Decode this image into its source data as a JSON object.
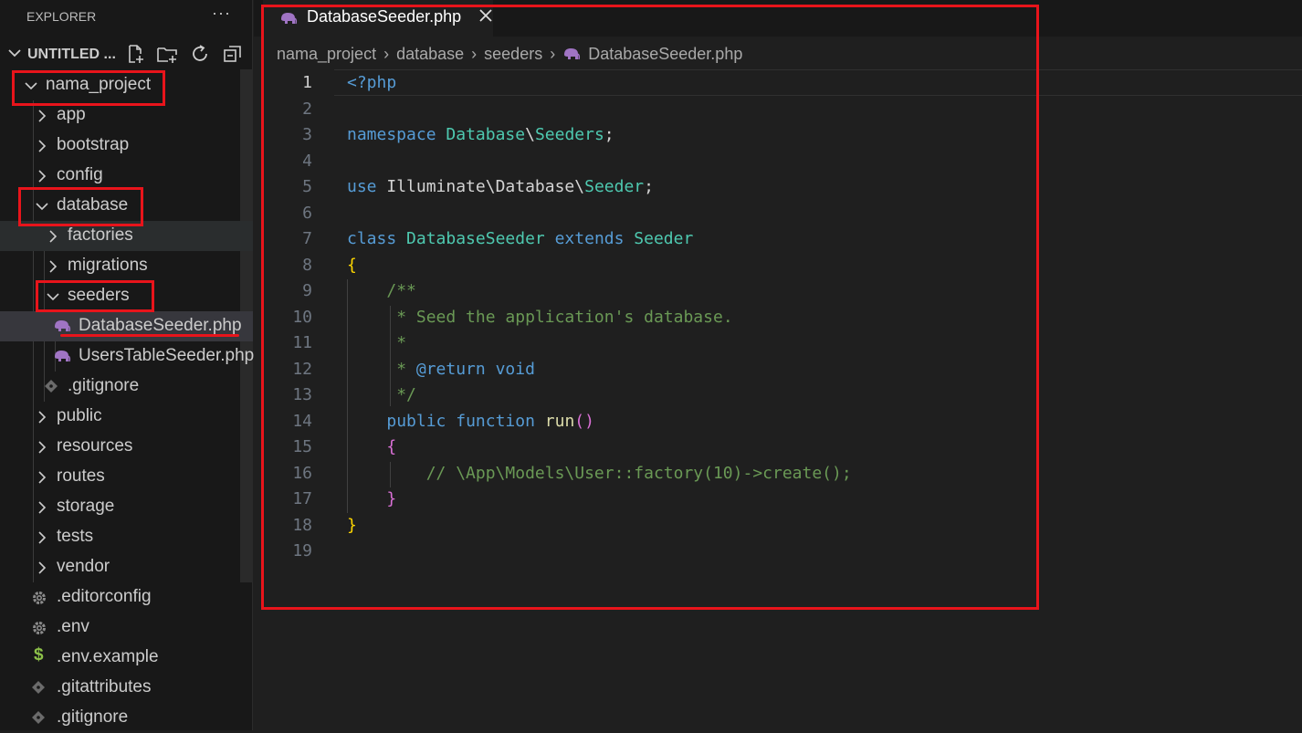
{
  "explorer": {
    "title": "EXPLORER",
    "more_icon": "ellipsis-icon",
    "workspace_name": "UNTITLED ...",
    "actions": [
      "new-file-icon",
      "new-folder-icon",
      "refresh-icon",
      "collapse-all-icon"
    ]
  },
  "tree": {
    "root": "nama_project",
    "app": "app",
    "bootstrap": "bootstrap",
    "config": "config",
    "database": "database",
    "factories": "factories",
    "migrations": "migrations",
    "seeders": "seeders",
    "database_seeder": "DatabaseSeeder.php",
    "users_table_seeder": "UsersTableSeeder.php",
    "db_gitignore": ".gitignore",
    "public": "public",
    "resources": "resources",
    "routes": "routes",
    "storage": "storage",
    "tests": "tests",
    "vendor": "vendor",
    "editorconfig": ".editorconfig",
    "env": ".env",
    "env_example": ".env.example",
    "gitattributes": ".gitattributes",
    "gitignore": ".gitignore"
  },
  "tab": {
    "title": "DatabaseSeeder.php",
    "icon": "php-elephant-icon",
    "close_icon": "close-icon"
  },
  "breadcrumb": {
    "items": [
      "nama_project",
      "database",
      "seeders",
      "DatabaseSeeder.php"
    ]
  },
  "editor": {
    "active_line": 1,
    "line_numbers": [
      "1",
      "2",
      "3",
      "4",
      "5",
      "6",
      "7",
      "8",
      "9",
      "10",
      "11",
      "12",
      "13",
      "14",
      "15",
      "16",
      "17",
      "18",
      "19"
    ],
    "code": {
      "l1": "<?php",
      "l3_kw": "namespace",
      "l3_ns1": "Database",
      "l3_sep": "\\",
      "l3_ns2": "Seeders",
      "l3_end": ";",
      "l5_kw": "use",
      "l5_ns1": "Illuminate",
      "l5_sep1": "\\",
      "l5_ns2": "Database",
      "l5_sep2": "\\",
      "l5_cls": "Seeder",
      "l5_end": ";",
      "l7_kw1": "class",
      "l7_cls": "DatabaseSeeder",
      "l7_kw2": "extends",
      "l7_parent": "Seeder",
      "l8": "{",
      "l9": "/**",
      "l10": " * Seed the application's database.",
      "l11": " *",
      "l12_pre": " * ",
      "l12_tag": "@return",
      "l12_type": "void",
      "l13": " */",
      "l14_kw1": "public",
      "l14_kw2": "function",
      "l14_fn": "run",
      "l14_paren": "()",
      "l15": "{",
      "l16": "// \\App\\Models\\User::factory(10)->create();",
      "l17": "}",
      "l18": "}"
    }
  },
  "colors": {
    "annotation_red": "#e8141b",
    "php_icon": "#a074c4",
    "gear_icon": "#8b8b8b",
    "dollar_icon": "#8dc149"
  }
}
